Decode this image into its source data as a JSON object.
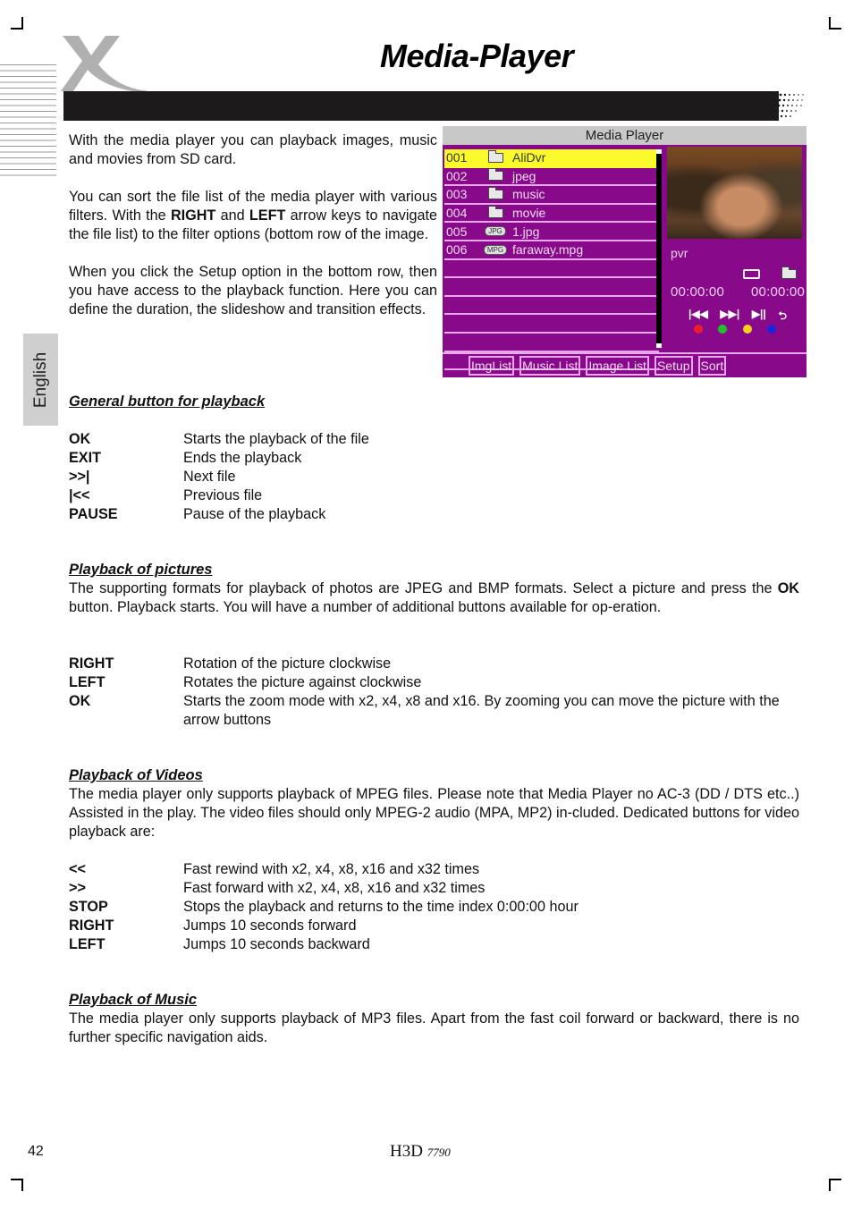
{
  "page": {
    "title": "Media-Player",
    "language_tab": "English",
    "page_number": "42",
    "footer_brand": "H3D",
    "footer_model": "7790"
  },
  "intro": {
    "p1": "With the media player you can playback images, music and movies from SD card.",
    "p2_before": "You can sort the file list of the media player with various filters. With the ",
    "p2_bold1": "RIGHT",
    "p2_mid": " and ",
    "p2_bold2": "LEFT",
    "p2_after": " arrow keys to navigate the file list) to the filter options (bottom row of the image.",
    "p3": "When you click the Setup option in the bottom row, then you have access to the playback function. Here you can define the duration, the slideshow and transition effects."
  },
  "media_player": {
    "title": "Media Player",
    "files": [
      {
        "num": "001",
        "type": "folder",
        "name": "AliDvr",
        "selected": true
      },
      {
        "num": "002",
        "type": "folder",
        "name": "jpeg"
      },
      {
        "num": "003",
        "type": "folder",
        "name": "music"
      },
      {
        "num": "004",
        "type": "folder",
        "name": "movie"
      },
      {
        "num": "005",
        "type": "JPG",
        "name": "1.jpg"
      },
      {
        "num": "006",
        "type": "MPG",
        "name": "faraway.mpg"
      }
    ],
    "empty_rows": 6,
    "preview_label": "pvr",
    "time_elapsed": "00:00:00",
    "time_total": "00:00:00",
    "controls": [
      "prev",
      "next",
      "play-pause",
      "repeat"
    ],
    "color_keys": [
      "#e8202a",
      "#1fc22a",
      "#f4d21a",
      "#1a24d8"
    ],
    "tabs": [
      "ImgList",
      "Music List",
      "Image List",
      "Setup",
      "Sort"
    ],
    "colors": {
      "background": "#880a8a",
      "selected": "#fbfb2b",
      "title_bar": "#c8c8c8"
    }
  },
  "general": {
    "heading": "General button for playback",
    "keys": [
      {
        "key": "OK",
        "desc": "Starts the playback of the file"
      },
      {
        "key": "EXIT",
        "desc": "Ends the playback"
      },
      {
        "key": ">>|",
        "desc": "Next file"
      },
      {
        "key": "|<<",
        "desc": "Previous file"
      },
      {
        "key": "PAUSE",
        "desc": "Pause of the playback"
      }
    ]
  },
  "pictures": {
    "heading": "Playback of pictures",
    "text_before": "The supporting formats for playback of photos are JPEG and BMP formats. Select a picture and press the ",
    "text_bold": "OK",
    "text_after": " button. Playback starts. You will have a number of additional buttons available for op-eration.",
    "keys": [
      {
        "key": "RIGHT",
        "desc": "Rotation of the picture clockwise"
      },
      {
        "key": "LEFT",
        "desc": "Rotates the picture against clockwise"
      },
      {
        "key": "OK",
        "desc": "Starts the zoom mode with x2, x4, x8 and x16. By zooming you can move the picture with the arrow buttons"
      }
    ]
  },
  "videos": {
    "heading": "Playback of Videos",
    "text": "The media player only supports playback of MPEG files. Please note that Media Player no AC-3 (DD / DTS etc..) Assisted in the play. The video files should only MPEG-2 audio (MPA, MP2) in-cluded. Dedicated buttons for video playback are:",
    "keys": [
      {
        "key": "<<",
        "desc": "Fast rewind with x2, x4, x8, x16 and x32 times"
      },
      {
        "key": ">>",
        "desc": "Fast forward with x2, x4, x8, x16 and x32 times"
      },
      {
        "key": "STOP",
        "desc": "Stops the playback and returns to the time index 0:00:00 hour"
      },
      {
        "key": "RIGHT",
        "desc": "Jumps 10 seconds forward"
      },
      {
        "key": "LEFT",
        "desc": "Jumps 10 seconds backward"
      }
    ]
  },
  "music": {
    "heading": "Playback of Music",
    "text": "The media player only supports playback of MP3 files. Apart from the fast coil forward or backward, there is no further specific navigation aids."
  }
}
